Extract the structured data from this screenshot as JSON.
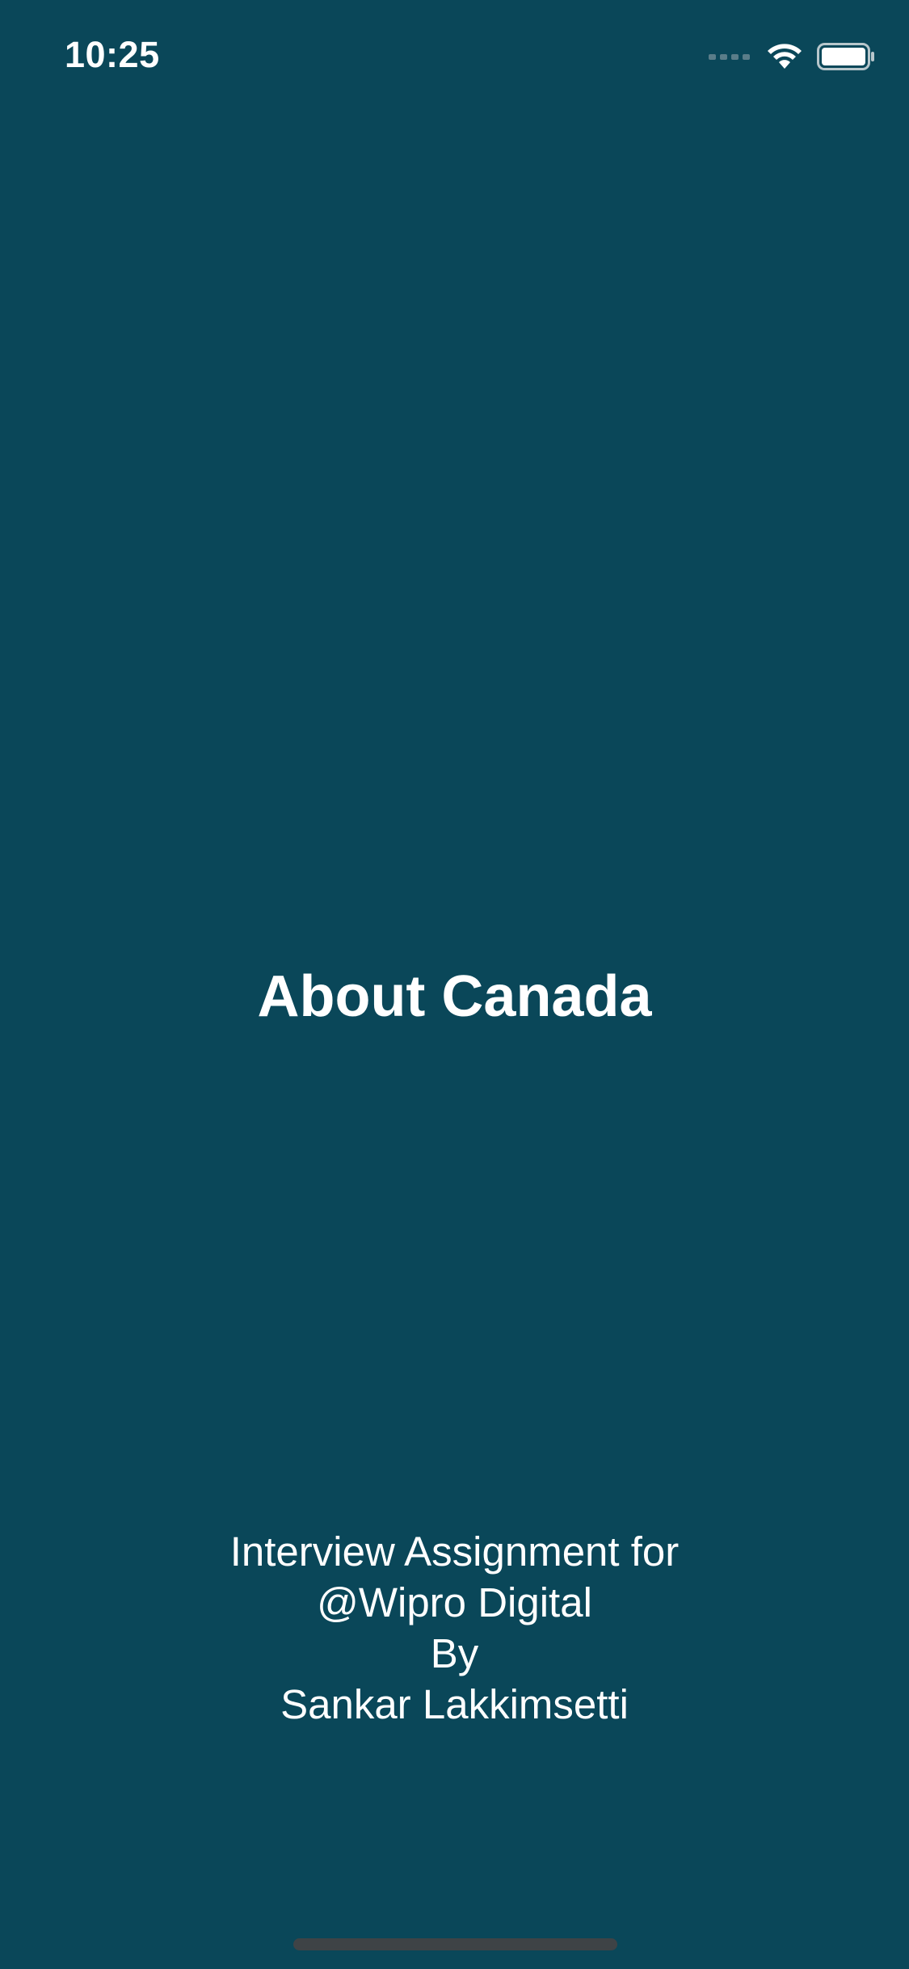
{
  "status_bar": {
    "time": "10:25",
    "icons": [
      "cellular-signal-icon",
      "wifi-icon",
      "battery-icon"
    ]
  },
  "main": {
    "title": "About Canada",
    "credits": [
      "Interview Assignment for",
      "@Wipro Digital",
      "By",
      "Sankar Lakkimsetti"
    ]
  },
  "colors": {
    "background": "#0a4759",
    "text": "#ffffff",
    "home_indicator": "#3e4346"
  }
}
